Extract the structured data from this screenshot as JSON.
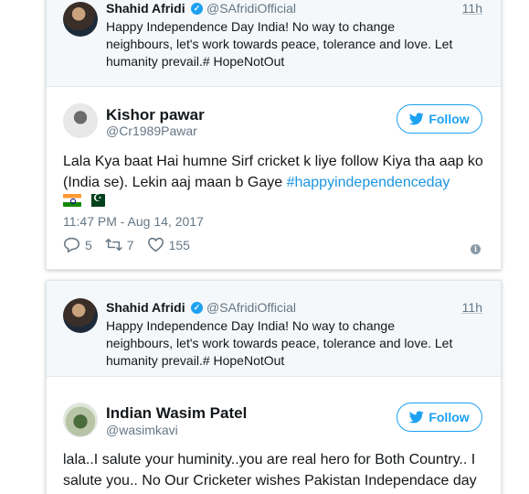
{
  "tweets": [
    {
      "quoted": {
        "name": "Shahid Afridi",
        "handle": "@SAfridiOfficial",
        "time": "11h",
        "text": "Happy Independence Day India! No way to change neighbours, let's work towards peace, tolerance and love. Let humanity prevail.# HopeNotOut"
      },
      "name": "Kishor pawar",
      "handle": "@Cr1989Pawar",
      "follow_label": "Follow",
      "text": "Lala Kya baat Hai humne Sirf cricket k liye follow Kiya tha aap ko (India se). Lekin aaj maan b Gaye ",
      "hashtag": "#happyindependenceday",
      "timestamp": "11:47 PM - Aug 14, 2017",
      "replies": "5",
      "retweets": "7",
      "likes": "155"
    },
    {
      "quoted": {
        "name": "Shahid Afridi",
        "handle": "@SAfridiOfficial",
        "time": "11h",
        "text": "Happy Independence Day India! No way to change neighbours, let's work towards peace, tolerance and love. Let humanity prevail.# HopeNotOut"
      },
      "name": "Indian Wasim Patel",
      "handle": "@wasimkavi",
      "follow_label": "Follow",
      "text": "lala..I salute your huminity..you are real hero for Both Country.. I salute you.. No Our Cricketer wishes Pakistan Independace day"
    }
  ],
  "colors": {
    "accent": "#1da1f2",
    "hashtag": "#1b95e0",
    "muted": "#657786",
    "quoted_bg": "#f5f8fa"
  },
  "icons": [
    "verified-icon",
    "twitter-bird-icon",
    "reply-icon",
    "retweet-icon",
    "like-icon",
    "info-icon",
    "india-flag-icon",
    "pakistan-flag-icon"
  ]
}
